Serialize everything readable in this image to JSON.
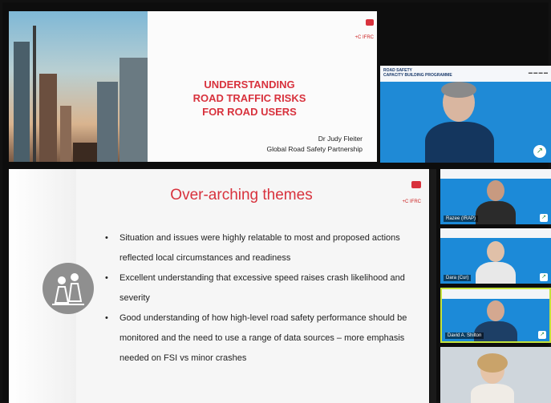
{
  "top_slide": {
    "title_lines": [
      "UNDERSTANDING",
      "ROAD TRAFFIC RISKS",
      "FOR ROAD USERS"
    ],
    "presenter": "Dr Judy Fleiter",
    "organisation": "Global Road Safety Partnership",
    "logo_text": "+C IFRC"
  },
  "top_video": {
    "banner_line1": "ROAD SAFETY",
    "banner_line2": "CAPACITY BUILDING PROGRAMME"
  },
  "main_slide": {
    "title": "Over-arching themes",
    "logo_text": "+C IFRC",
    "bullets": [
      "Situation and issues were highly relatable to most and proposed actions reflected local circumstances and readiness",
      "Excellent understanding that excessive speed raises crash likelihood and severity",
      "Good understanding of how high-level road safety performance should be monitored and the need to use a range of data sources – more emphasis needed on FSI vs minor crashes"
    ]
  },
  "participants": [
    {
      "name": "Razee (IRAP)"
    },
    {
      "name": "Dara (Cur)"
    },
    {
      "name": "David A. Shilton"
    },
    {
      "name": ""
    }
  ],
  "colors": {
    "title_red": "#d8323d",
    "video_blue": "#1c8ad8",
    "active_speaker": "#c5e33a"
  }
}
